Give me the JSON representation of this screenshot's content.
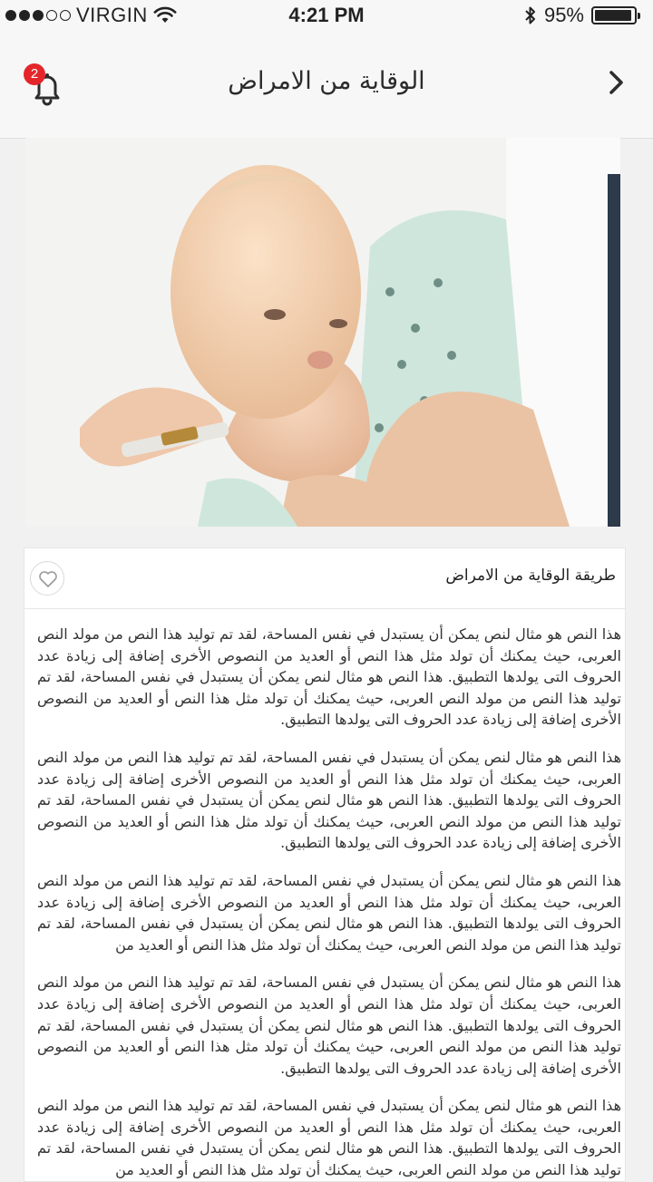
{
  "status_bar": {
    "carrier": "VIRGIN",
    "time": "4:21 PM",
    "battery": "95%",
    "signal_bars": 3,
    "signal_total": 5,
    "battery_level": 0.95
  },
  "header": {
    "title": "الوقاية من الامراض",
    "notification_count": "2"
  },
  "article": {
    "title": "طريقة الوقاية من الامراض",
    "paragraphs": [
      "هذا النص هو مثال لنص يمكن أن يستبدل في نفس المساحة، لقد تم توليد هذا النص من مولد النص العربى، حيث يمكنك أن تولد مثل هذا النص أو العديد من النصوص الأخرى إضافة إلى زيادة عدد الحروف التى يولدها التطبيق. هذا النص هو مثال لنص يمكن أن يستبدل في نفس المساحة، لقد تم توليد هذا النص من مولد النص العربى، حيث يمكنك أن تولد مثل هذا النص أو العديد من النصوص الأخرى إضافة إلى زيادة عدد الحروف التى يولدها التطبيق.",
      "هذا النص هو مثال لنص يمكن أن يستبدل في نفس المساحة، لقد تم توليد هذا النص من مولد النص العربى، حيث يمكنك أن تولد مثل هذا النص أو العديد من النصوص الأخرى إضافة إلى زيادة عدد الحروف التى يولدها التطبيق. هذا النص هو مثال لنص يمكن أن يستبدل في نفس المساحة، لقد تم توليد هذا النص من مولد النص العربى، حيث يمكنك أن تولد مثل هذا النص أو العديد من النصوص الأخرى إضافة إلى زيادة عدد الحروف التى يولدها التطبيق.",
      "هذا النص هو مثال لنص يمكن أن يستبدل في نفس المساحة، لقد تم توليد هذا النص من مولد النص العربى، حيث يمكنك أن تولد مثل هذا النص أو العديد من النصوص الأخرى إضافة إلى زيادة عدد الحروف التى يولدها التطبيق. هذا النص هو مثال لنص يمكن أن يستبدل في نفس المساحة، لقد تم توليد هذا النص من مولد النص العربى، حيث يمكنك أن تولد مثل هذا النص أو العديد من",
      "هذا النص هو مثال لنص يمكن أن يستبدل في نفس المساحة، لقد تم توليد هذا النص من مولد النص العربى، حيث يمكنك أن تولد مثل هذا النص أو العديد من النصوص الأخرى إضافة إلى زيادة عدد الحروف التى يولدها التطبيق. هذا النص هو مثال لنص يمكن أن يستبدل في نفس المساحة، لقد تم توليد هذا النص من مولد النص العربى، حيث يمكنك أن تولد مثل هذا النص أو العديد من النصوص الأخرى إضافة إلى زيادة عدد الحروف التى يولدها التطبيق.",
      "هذا النص هو مثال لنص يمكن أن يستبدل في نفس المساحة، لقد تم توليد هذا النص من مولد النص العربى، حيث يمكنك أن تولد مثل هذا النص أو العديد من النصوص الأخرى إضافة إلى زيادة عدد الحروف التى يولدها التطبيق. هذا النص هو مثال لنص يمكن أن يستبدل في نفس المساحة، لقد تم توليد هذا النص من مولد النص العربى، حيث يمكنك أن تولد مثل هذا النص أو العديد من"
    ]
  },
  "icons": {
    "wifi": "wifi-icon",
    "bluetooth": "bluetooth-icon",
    "battery": "battery-icon",
    "notifications": "bell-icon",
    "back": "chevron-right-icon",
    "favorite": "heart-icon"
  },
  "colors": {
    "badge": "#e4262a",
    "background": "#f1f1f1",
    "header": "#f7f7f7"
  }
}
